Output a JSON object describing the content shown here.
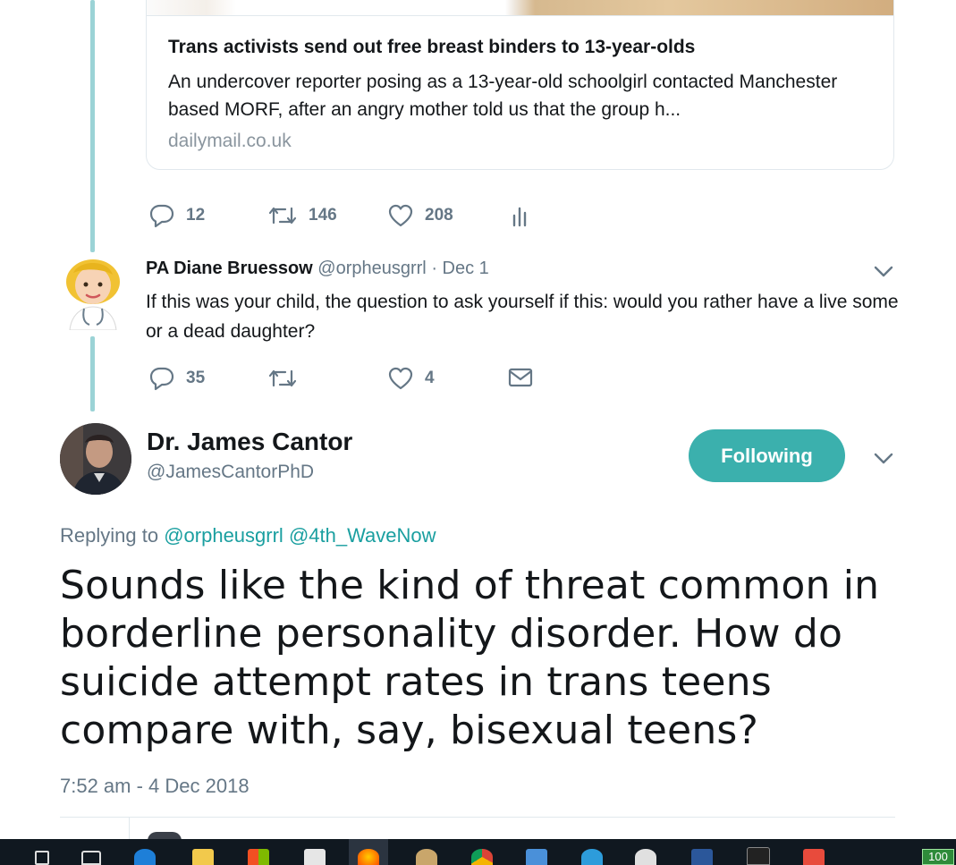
{
  "link_card": {
    "title": "Trans activists send out free breast binders to 13-year-olds",
    "description": "An undercover reporter posing as a 13-year-old schoolgirl contacted Manchester based MORF, after an angry mother told us that the group h...",
    "domain": "dailymail.co.uk"
  },
  "parent_actions": {
    "replies": "12",
    "retweets": "146",
    "likes": "208"
  },
  "reply": {
    "display_name": "PA Diane Bruessow",
    "handle": "@orpheusgrrl",
    "separator": "·",
    "date": "Dec 1",
    "text": "If this was your child, the question to ask yourself if this: would you rather have a live some or a dead daughter?",
    "actions": {
      "replies": "35",
      "likes": "4"
    }
  },
  "main_tweet": {
    "display_name": "Dr. James Cantor",
    "handle": "@JamesCantorPhD",
    "follow_label": "Following",
    "replying_prefix": "Replying to",
    "replying_mentions": [
      "@orpheusgrrl",
      "@4th_WaveNow"
    ],
    "text": "Sounds like the kind of threat common in borderline personality disorder.  How do suicide attempt rates in trans teens compare with, say, bisexual teens?",
    "timestamp": "7:52 am - 4 Dec 2018"
  },
  "taskbar": {
    "battery_label": "100",
    "icons": [
      "search-icon",
      "task-view-icon",
      "edge-icon",
      "file-explorer-icon",
      "store-icon",
      "mail-icon",
      "firefox-icon",
      "paint-icon",
      "chrome-icon",
      "calculator-icon",
      "camera-icon",
      "satellite-icon",
      "word-icon",
      "game-icon",
      "ss-icon"
    ]
  },
  "colors": {
    "accent": "#3bb0ad",
    "muted": "#657786",
    "thread": "#9bd3d6",
    "mention": "#1a9fa0"
  }
}
